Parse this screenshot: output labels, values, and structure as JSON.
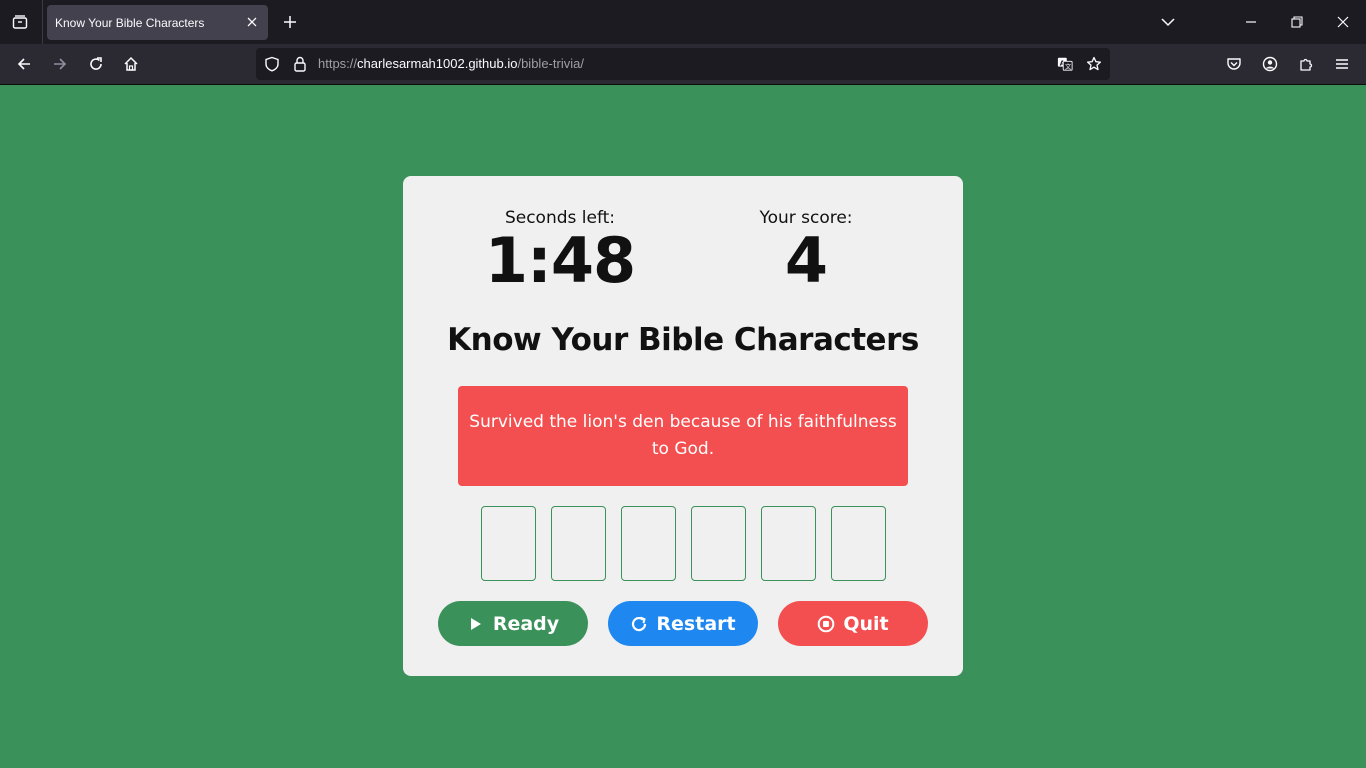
{
  "browser": {
    "tab_title": "Know Your Bible Characters",
    "url": {
      "scheme": "https://",
      "host": "charlesarmah1002.github.io",
      "path": "/bible-trivia/"
    }
  },
  "game": {
    "timer_label": "Seconds left:",
    "timer_value": "1:48",
    "score_label": "Your score:",
    "score_value": "4",
    "title": "Know Your Bible Characters",
    "clue": "Survived the lion's den because of his faithfulness to God.",
    "letter_slots": [
      "",
      "",
      "",
      "",
      "",
      ""
    ],
    "buttons": {
      "ready": "Ready",
      "restart": "Restart",
      "quit": "Quit"
    }
  },
  "colors": {
    "page_background": "#3b915a",
    "card_background": "#f0f0f0",
    "clue_background": "#f44f50",
    "ready_button": "#3b915a",
    "restart_button": "#1e87f0",
    "quit_button": "#f44f50"
  },
  "icons": {
    "tab_list": "tab-list-icon",
    "close_tab": "close-icon",
    "new_tab": "plus-icon",
    "list_all_tabs": "chevron-down-icon",
    "minimize": "minimize-icon",
    "restore": "restore-icon",
    "close_window": "close-icon",
    "back": "arrow-left-icon",
    "forward": "arrow-right-icon",
    "reload": "reload-icon",
    "home": "home-icon",
    "tracking_protection": "shield-icon",
    "secure": "lock-icon",
    "translate": "translate-icon",
    "bookmark": "star-icon",
    "pocket": "pocket-icon",
    "account": "account-icon",
    "extensions": "puzzle-icon",
    "menu": "hamburger-icon",
    "ready": "play-icon",
    "restart": "restart-icon",
    "quit": "stop-icon"
  }
}
